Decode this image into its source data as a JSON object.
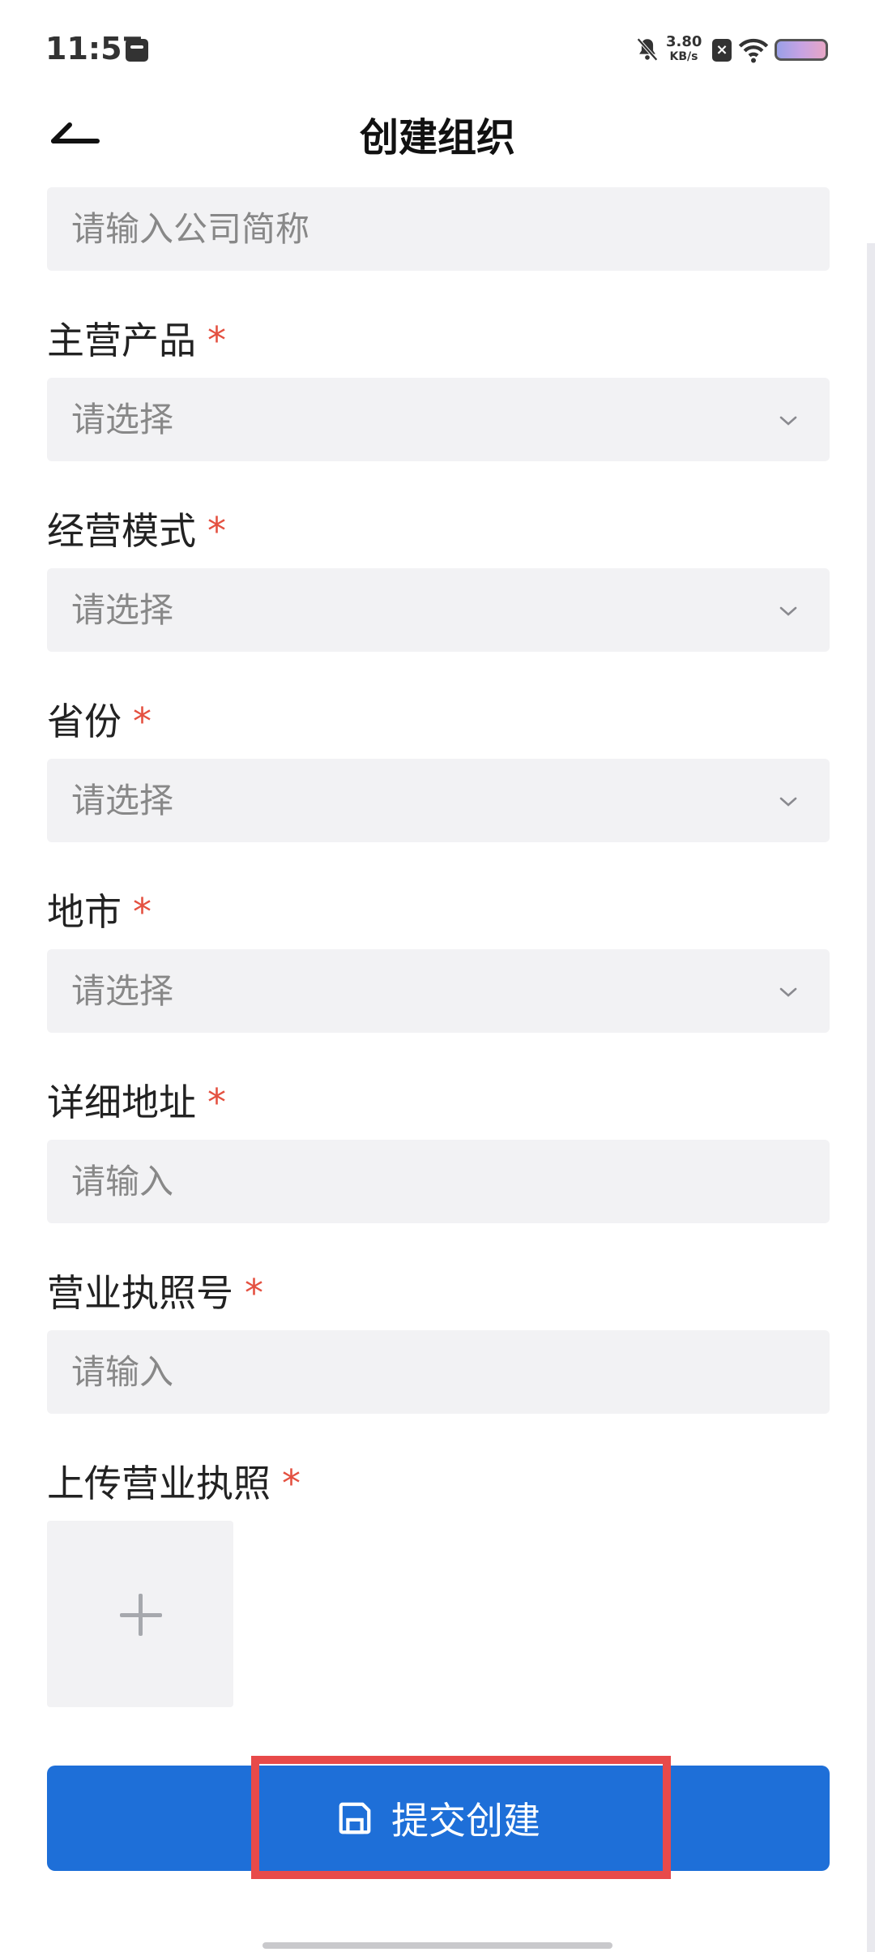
{
  "status_bar": {
    "time": "11:57",
    "net_speed_value": "3.80",
    "net_speed_unit": "KB/s"
  },
  "header": {
    "title": "创建组织"
  },
  "form": {
    "company_short": {
      "placeholder": "请输入公司简称"
    },
    "main_product": {
      "label": "主营产品",
      "required": "*",
      "placeholder": "请选择"
    },
    "business_mode": {
      "label": "经营模式",
      "required": "*",
      "placeholder": "请选择"
    },
    "province": {
      "label": "省份",
      "required": "*",
      "placeholder": "请选择"
    },
    "city": {
      "label": "地市",
      "required": "*",
      "placeholder": "请选择"
    },
    "address": {
      "label": "详细地址",
      "required": "*",
      "placeholder": "请输入"
    },
    "license_no": {
      "label": "营业执照号",
      "required": "*",
      "placeholder": "请输入"
    },
    "license_upload": {
      "label": "上传营业执照",
      "required": "*"
    }
  },
  "submit": {
    "label": "提交创建"
  },
  "colors": {
    "primary": "#1e6fd8",
    "required": "#e45141",
    "highlight": "#e84a4a",
    "input_bg": "#f2f2f4"
  }
}
